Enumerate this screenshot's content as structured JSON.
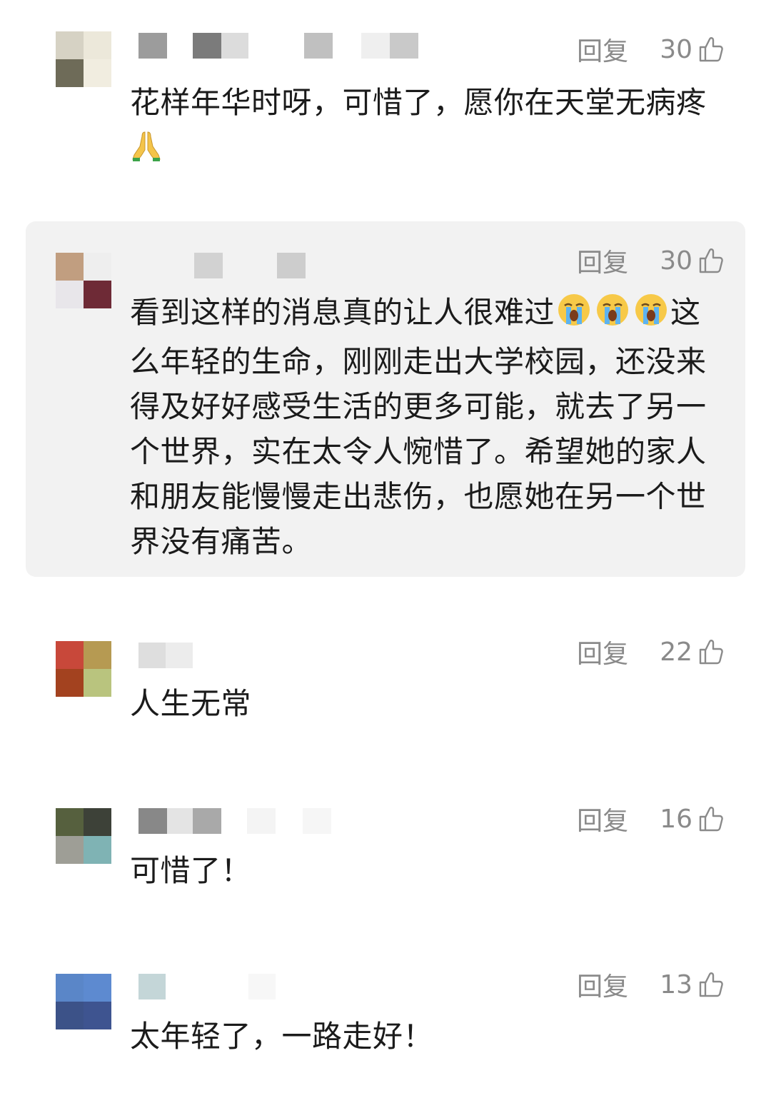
{
  "comments": [
    {
      "reply_label": "回复",
      "likes": "30",
      "text": "花样年华时呀，可惜了，愿你在天堂无病疼",
      "emoji": "folded-hands",
      "avatar_colors": [
        "#d6d2c4",
        "#ece8da",
        "#6e6b58",
        "#f1ede0"
      ],
      "name_blocks": [
        "#9c9c9c",
        "#ffffff",
        "#7b7b7b",
        "#dcdcdc",
        "#ffffff",
        "#c0c0c0",
        "#ffffff",
        "#efefef",
        "#c9c9c9"
      ]
    },
    {
      "reply_label": "回复",
      "likes": "30",
      "text_before_emoji": "看到这样的消息真的让人很难过",
      "emoji": "loudly-crying-face x3",
      "text_after_emoji": "这么年轻的生命，刚刚走出大学校园，还没来得及好好感受生活的更多可能，就去了另一个世界，实在太令人惋惜了。希望她的家人和朋友能慢慢走出悲伤，也愿她在另一个世界没有痛苦。",
      "avatar_colors": [
        "#c19e80",
        "#eeeeee",
        "#e8e6ea",
        "#6e2a36"
      ],
      "name_blocks": [
        "#f2f2f2",
        "#d2d2d2",
        "#f2f2f2",
        "#cdcdcd"
      ]
    },
    {
      "reply_label": "回复",
      "likes": "22",
      "text": "人生无常",
      "avatar_colors": [
        "#c8483a",
        "#b69a52",
        "#a3421f",
        "#b9c47e"
      ],
      "name_blocks": [
        "#dedede",
        "#ececec"
      ]
    },
    {
      "reply_label": "回复",
      "likes": "16",
      "text": "可惜了！",
      "avatar_colors": [
        "#56603e",
        "#3d4138",
        "#9e9e96",
        "#7fb3b4"
      ],
      "name_blocks": [
        "#888888",
        "#e4e4e4",
        "#a9a9a9",
        "#ffffff",
        "#f4f4f4",
        "#ffffff",
        "#f6f6f6"
      ]
    },
    {
      "reply_label": "回复",
      "likes": "13",
      "text": "太年轻了，一路走好！",
      "avatar_colors": [
        "#5a86c8",
        "#5d8ad0",
        "#3c5288",
        "#3e5490"
      ],
      "name_blocks": [
        "#c4d6d8",
        "#ffffff",
        "#f7f7f7"
      ]
    }
  ],
  "colors": {
    "meta_gray": "#8a8a8a",
    "text": "#1b1b1b",
    "highlight_bg": "#f2f2f2"
  }
}
